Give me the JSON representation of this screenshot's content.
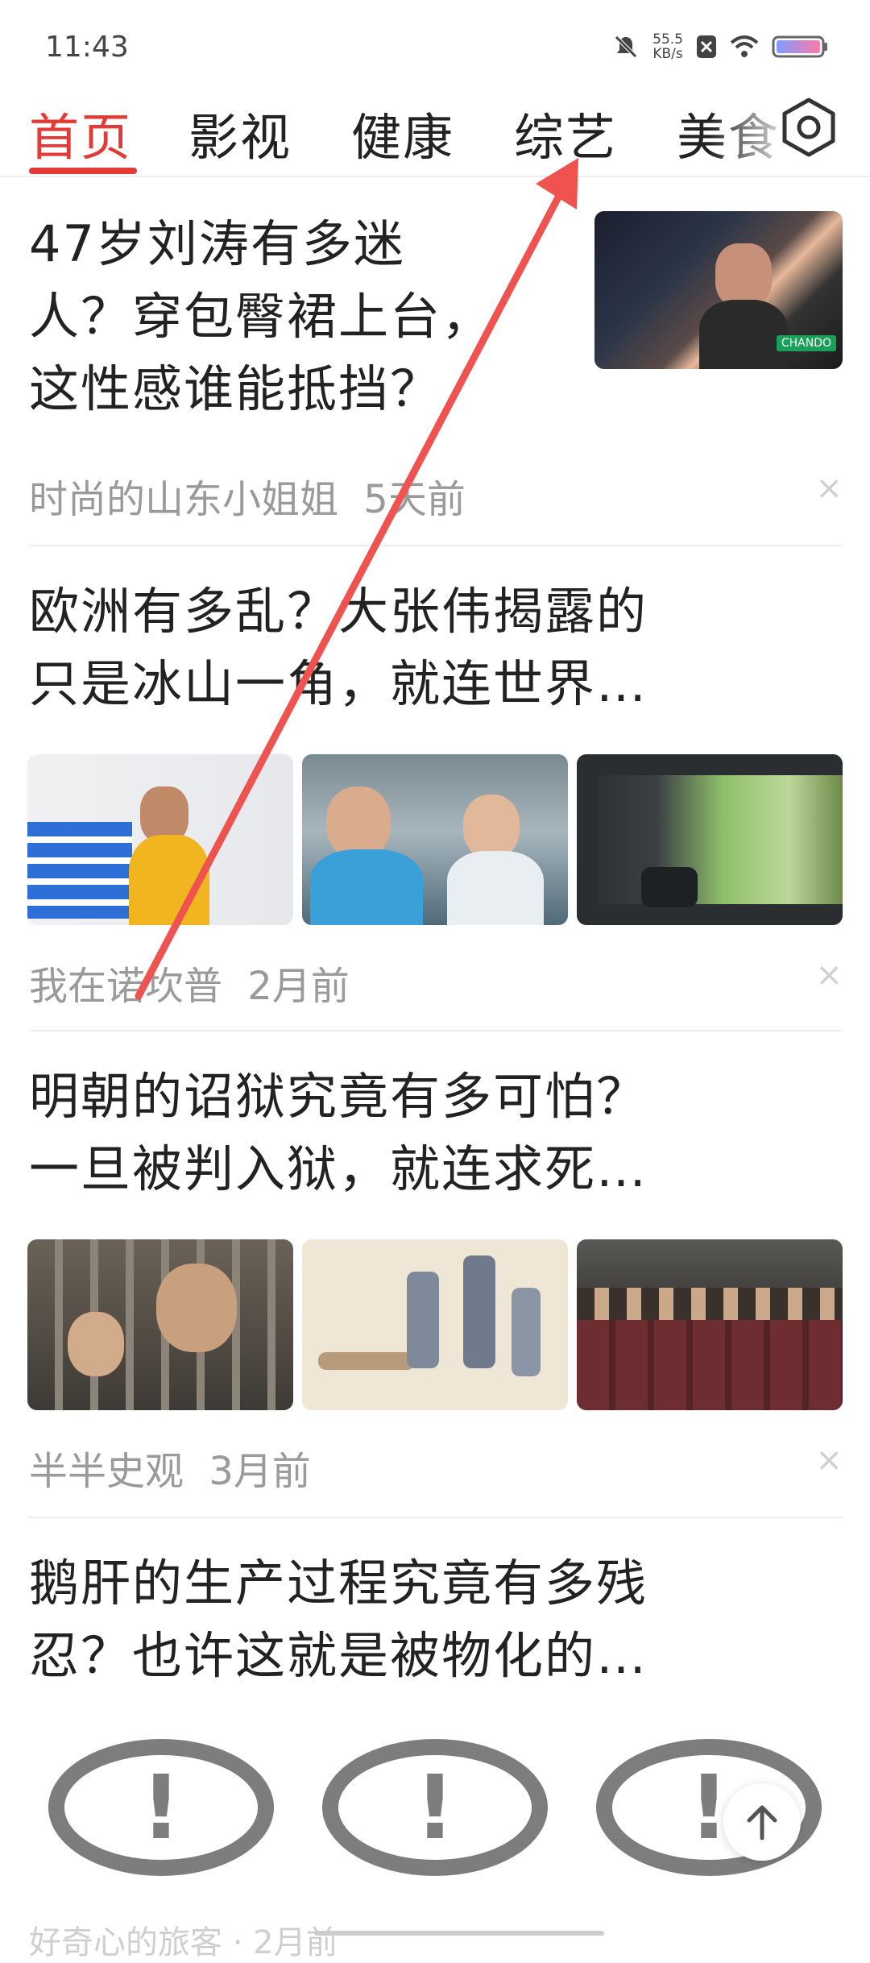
{
  "status_bar": {
    "time": "11:43",
    "net_speed_value": "55.5",
    "net_speed_unit": "KB/s"
  },
  "tabs": [
    {
      "label": "首页",
      "active": true
    },
    {
      "label": "影视",
      "active": false
    },
    {
      "label": "健康",
      "active": false
    },
    {
      "label": "综艺",
      "active": false
    },
    {
      "label": "美食",
      "active": false
    }
  ],
  "articles": [
    {
      "title_lines": [
        "47岁刘涛有多迷",
        "人？穿包臀裙上台，",
        "这性感谁能抵挡？"
      ],
      "source": "时尚的山东小姐姐",
      "time": "5天前",
      "thumb_caption": "CHANDO"
    },
    {
      "title_lines": [
        "欧洲有多乱？大张伟揭露的",
        "只是冰山一角，就连世界…"
      ],
      "source": "我在诺坎普",
      "time": "2月前"
    },
    {
      "title_lines": [
        "明朝的诏狱究竟有多可怕？",
        "一旦被判入狱，就连求死…"
      ],
      "source": "半半史观",
      "time": "3月前"
    },
    {
      "title_lines": [
        "鹅肝的生产过程究竟有多残",
        "忍？也许这就是被物化的…"
      ]
    }
  ],
  "close_symbol": "×",
  "bubbles": [
    "!",
    "!",
    "!"
  ],
  "bottom_peek": "好奇心的旅客 · 2月前",
  "colors": {
    "accent": "#e53935",
    "arrow": "#ef5350"
  }
}
